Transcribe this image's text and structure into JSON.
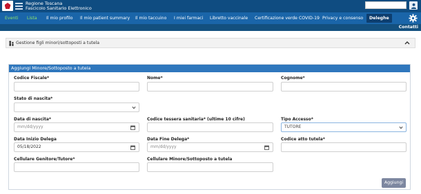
{
  "brand": {
    "line1": "Regione Toscana",
    "line2": "Fascicolo Sanitario Elettronico"
  },
  "nav": {
    "items": [
      {
        "label": "Eventi"
      },
      {
        "label": "Lista"
      },
      {
        "label": "Il mio profilo"
      },
      {
        "label": "Il mio patient summary"
      },
      {
        "label": "Il mio taccuino"
      },
      {
        "label": "I miei farmaci"
      },
      {
        "label": "Libretto vaccinale"
      },
      {
        "label": "Certificazione verde COVID-19"
      },
      {
        "label": "Privacy e consenso"
      },
      {
        "label": "Deleghe"
      }
    ],
    "contatti": "Contatti"
  },
  "panel": {
    "title": "Gestione figli minori/sottoposti a tutela"
  },
  "form": {
    "title": "Aggiungi Minore/Sottoposto a tutela",
    "codice_fiscale": {
      "label": "Codice Fiscale*",
      "value": ""
    },
    "nome": {
      "label": "Nome*",
      "value": ""
    },
    "cognome": {
      "label": "Cognome*",
      "value": ""
    },
    "stato_nascita": {
      "label": "Stato di nascita*",
      "value": ""
    },
    "data_nascita": {
      "label": "Data di nascita*",
      "placeholder": "mm/dd/yyyy"
    },
    "tessera": {
      "label": "Codice tessera sanitaria* (ultime 10 cifre)",
      "value": ""
    },
    "tipo_accesso": {
      "label": "Tipo Accesso*",
      "value": "TUTORE"
    },
    "data_inizio": {
      "label": "Data Inizio Delega",
      "value": "05/18/2022"
    },
    "data_fine": {
      "label": "Data Fine Delega*",
      "placeholder": "mm/dd/yyyy"
    },
    "codice_atto": {
      "label": "Codice atto tutela*",
      "value": ""
    },
    "cell_genitore": {
      "label": "Cellulare Genitore/Tutore*",
      "value": ""
    },
    "cell_minore": {
      "label": "Cellulare Minore/Sottoposto a tutela",
      "value": ""
    },
    "submit_label": "Aggiungi"
  },
  "colors": {
    "header": "#0f4c81",
    "nav": "#1a65a9",
    "card_head": "#2f77bd",
    "accent_green": "#8fe36a"
  }
}
